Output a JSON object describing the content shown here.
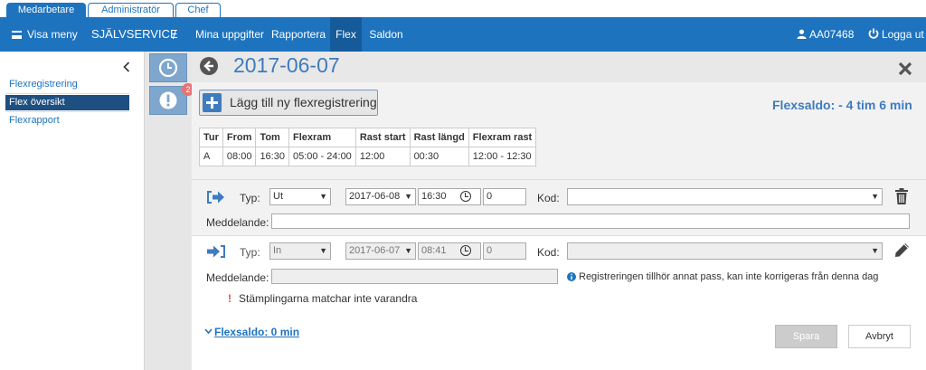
{
  "role_tabs": [
    "Medarbetare",
    "Administratör",
    "Chef"
  ],
  "nav": {
    "menu_label": "Visa meny",
    "brand": "SJÄLVSERVICE",
    "separator": "/",
    "items": [
      "Mina uppgifter",
      "Rapportera",
      "Flex",
      "Saldon"
    ],
    "active_item": "Flex",
    "user_id": "AA07468",
    "logout_label": "Logga ut"
  },
  "sidebar": {
    "items": [
      "Flexregistrering",
      "Flex översikt",
      "Flexrapport"
    ],
    "active_item": "Flex översikt"
  },
  "icon_column": {
    "badge_count": "2"
  },
  "main": {
    "date_title": "2017-06-07",
    "add_button_label": "Lägg till ny flexregistrering",
    "flexsaldo_header": "Flexsaldo: - 4 tim 6 min",
    "pass_table": {
      "headers": [
        "Tur",
        "From",
        "Tom",
        "Flexram",
        "Rast start",
        "Rast längd",
        "Flexram rast"
      ],
      "rows": [
        [
          "A",
          "08:00",
          "16:30",
          "05:00 - 24:00",
          "12:00",
          "00:30",
          "12:00 - 12:30"
        ]
      ]
    },
    "registrations": [
      {
        "direction_icon": "sign-out-icon",
        "typ_label": "Typ:",
        "typ_value": "Ut",
        "date": "2017-06-08",
        "time": "16:30",
        "number": "0",
        "kod_label": "Kod:",
        "kod_value": "",
        "meddelande_label": "Meddelande:",
        "meddelande_value": "",
        "action_icon": "trash-icon",
        "disabled": false,
        "info": ""
      },
      {
        "direction_icon": "sign-in-icon",
        "typ_label": "Typ:",
        "typ_value": "In",
        "date": "2017-06-07",
        "time": "08:41",
        "number": "0",
        "kod_label": "Kod:",
        "kod_value": "",
        "meddelande_label": "Meddelande:",
        "meddelande_value": "",
        "action_icon": "pencil-icon",
        "disabled": true,
        "info": "Registreringen tillhör annat pass, kan inte korrigeras från denna dag"
      }
    ],
    "warning": "Stämplingarna matchar inte varandra",
    "flexsaldo_link": "Flexsaldo: 0 min",
    "save_label": "Spara",
    "cancel_label": "Avbryt"
  },
  "colors": {
    "primary": "#1e73be",
    "nav_active": "#155a99",
    "title_blue": "#3e7bbf",
    "sidebar_active": "#1d4f80",
    "badge": "#e67373",
    "warning": "#d9534f"
  }
}
